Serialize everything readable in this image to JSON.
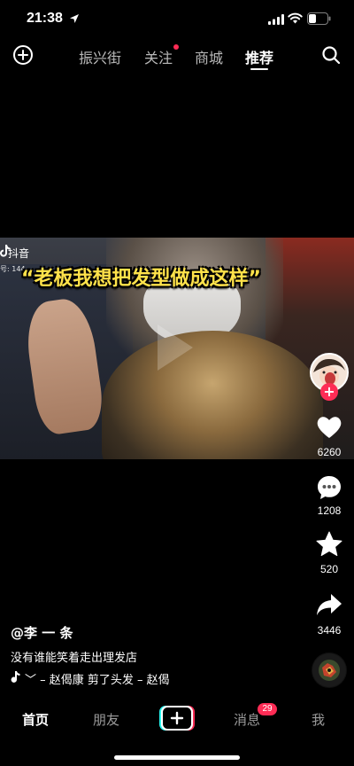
{
  "status_bar": {
    "time": "21:38"
  },
  "top_nav": {
    "tabs": [
      {
        "label": "振兴街"
      },
      {
        "label": "关注"
      },
      {
        "label": "商城"
      },
      {
        "label": "推荐"
      }
    ],
    "active_tab": "推荐"
  },
  "video": {
    "watermark": "抖音",
    "watermark_id": "号: 144",
    "caption": "“老板我想把发型做成这样”"
  },
  "actions": {
    "likes": "6260",
    "comments": "1208",
    "favorites": "520",
    "shares": "3446"
  },
  "post": {
    "author": "@李 一 条",
    "description": "没有谁能笑着走出理发店",
    "music": "﹀ – 赵偈康    剪了头发 – 赵偈"
  },
  "bottom_nav": {
    "home": "首页",
    "friends": "朋友",
    "messages": "消息",
    "messages_badge": "29",
    "me": "我"
  },
  "colors": {
    "accent": "#fe2c55",
    "caption_yellow": "#ffe24a",
    "background": "#000000"
  }
}
